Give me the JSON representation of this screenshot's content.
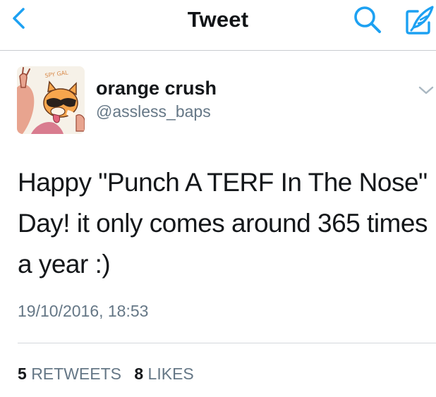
{
  "navbar": {
    "title": "Tweet",
    "back_icon": "chevron-left-icon",
    "search_icon": "search-icon",
    "compose_icon": "compose-icon",
    "accent_color": "#1da1f2"
  },
  "tweet": {
    "author": {
      "display_name": "orange crush",
      "handle": "@assless_baps",
      "avatar_text": "SPY GAL"
    },
    "caret_icon": "chevron-down-icon",
    "text": "Happy \"Punch A TERF In The Nose\" Day! it only comes around 365 times a year :)",
    "timestamp": "19/10/2016, 18:53",
    "stats": {
      "retweets_count": "5",
      "retweets_label": "RETWEETS",
      "likes_count": "8",
      "likes_label": "LIKES"
    }
  }
}
